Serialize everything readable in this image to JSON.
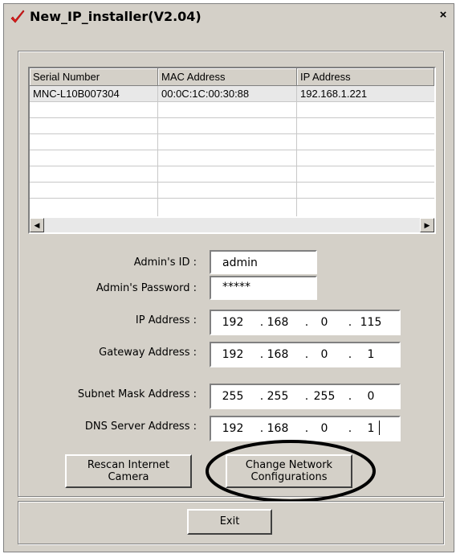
{
  "window": {
    "title": "New_IP_installer(V2.04)",
    "close_glyph": "×"
  },
  "table": {
    "columns": [
      "Serial Number",
      "MAC Address",
      "IP Address"
    ],
    "rows": [
      [
        "MNC-L10B007304",
        "00:0C:1C:00:30:88",
        "192.168.1.221"
      ]
    ],
    "scroll_left_glyph": "◀",
    "scroll_right_glyph": "▶"
  },
  "form": {
    "admin_id": {
      "label": "Admin's ID :",
      "value": "admin"
    },
    "admin_password": {
      "label": "Admin's Password :",
      "value": "*****"
    },
    "ip_address": {
      "label": "IP Address :",
      "octets": [
        "192",
        "168",
        "0",
        "115"
      ]
    },
    "gateway_address": {
      "label": "Gateway Address :",
      "octets": [
        "192",
        "168",
        "0",
        "1"
      ]
    },
    "subnet_mask": {
      "label": "Subnet Mask Address :",
      "octets": [
        "255",
        "255",
        "255",
        "0"
      ]
    },
    "dns_server": {
      "label": "DNS Server Address :",
      "octets": [
        "192",
        "168",
        "0",
        "1"
      ]
    }
  },
  "buttons": {
    "rescan_line1": "Rescan Internet",
    "rescan_line2": "Camera",
    "change_line1": "Change Network",
    "change_line2": "Configurations",
    "exit": "Exit"
  },
  "icons": {
    "app": "checkmark-icon",
    "close": "close-icon"
  },
  "colors": {
    "window_bg": "#d4d0c8",
    "check_red": "#e02020",
    "highlight_ellipse": "#000000"
  }
}
